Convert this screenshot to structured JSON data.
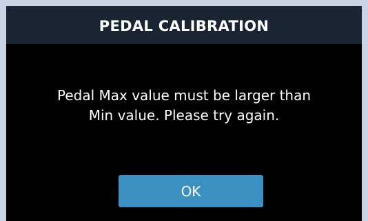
{
  "dialog": {
    "title": "PEDAL CALIBRATION",
    "message_lines": [
      "Pedal Max value must be larger than",
      "Min value. Please try again."
    ],
    "ok_label": "OK"
  },
  "colors": {
    "frame_background": "#c9d3e3",
    "dialog_background": "#000000",
    "titlebar_background": "#1a2433",
    "button_background": "#3b92c2",
    "text": "#ffffff"
  }
}
